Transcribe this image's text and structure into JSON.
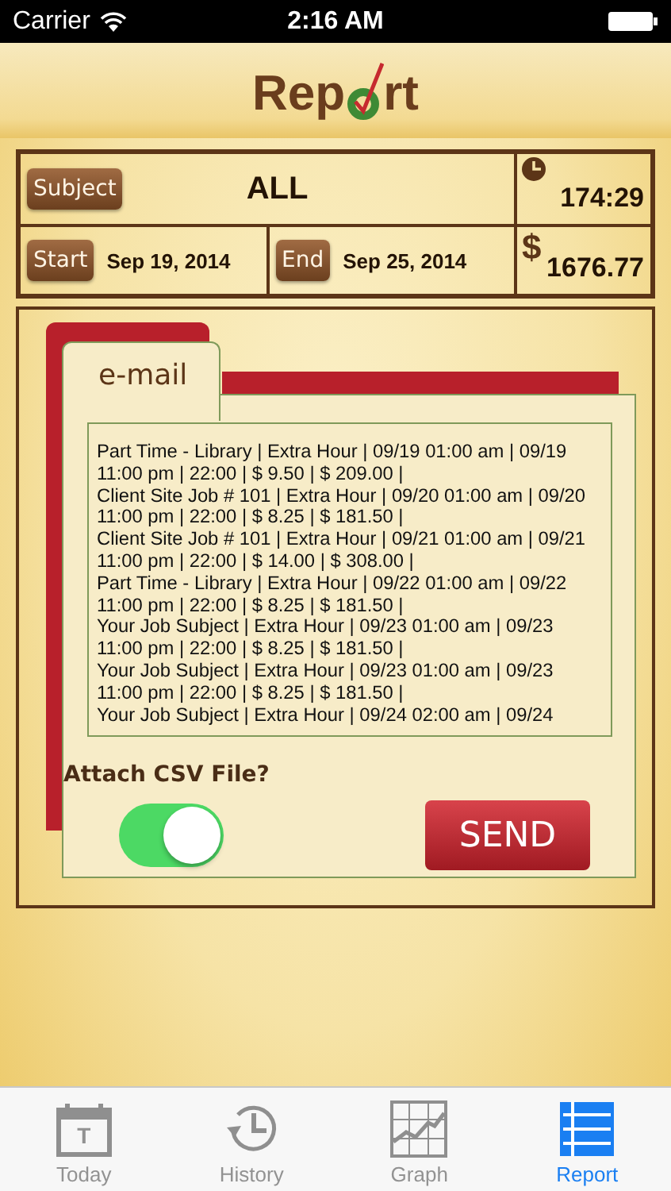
{
  "status_bar": {
    "carrier": "Carrier",
    "time": "2:16 AM"
  },
  "header": {
    "title_before": "Rep",
    "title_after": "rt"
  },
  "summary": {
    "subject_button": "Subject",
    "subject_value": "ALL",
    "hours": "174:29",
    "money_symbol": "$",
    "money": "1676.77",
    "start_button": "Start",
    "start_date": "Sep 19, 2014",
    "end_button": "End",
    "end_date": "Sep 25, 2014"
  },
  "email": {
    "tab": "e-mail",
    "lines": [
      "Part Time - Library | Extra Hour | 09/19 01:00 am | 09/19",
      "11:00 pm | 22:00 | $ 9.50 | $ 209.00 |",
      "Client Site Job # 101 | Extra Hour | 09/20 01:00 am | 09/20",
      "11:00 pm | 22:00 | $ 8.25 | $ 181.50 |",
      "Client Site Job # 101 | Extra Hour | 09/21 01:00 am | 09/21",
      "11:00 pm | 22:00 | $ 14.00 | $ 308.00 |",
      "Part Time - Library | Extra Hour | 09/22 01:00 am | 09/22",
      "11:00 pm | 22:00 | $ 8.25 | $ 181.50 |",
      "Your Job Subject | Extra Hour | 09/23 01:00 am | 09/23",
      "11:00 pm | 22:00 | $ 8.25 | $ 181.50 |",
      "Your Job Subject | Extra Hour | 09/23 01:00 am | 09/23",
      "11:00 pm | 22:00 | $ 8.25 | $ 181.50 |",
      "Your Job Subject | Extra Hour | 09/24 02:00 am | 09/24"
    ],
    "attach_label": "Attach CSV File?",
    "attach_on": true,
    "send_button": "SEND"
  },
  "tabs": [
    {
      "label": "Today",
      "kind": "calendar",
      "icon_letter": "T",
      "selected": false
    },
    {
      "label": "History",
      "kind": "history",
      "selected": false
    },
    {
      "label": "Graph",
      "kind": "graph",
      "selected": false
    },
    {
      "label": "Report",
      "kind": "list",
      "selected": true
    }
  ]
}
